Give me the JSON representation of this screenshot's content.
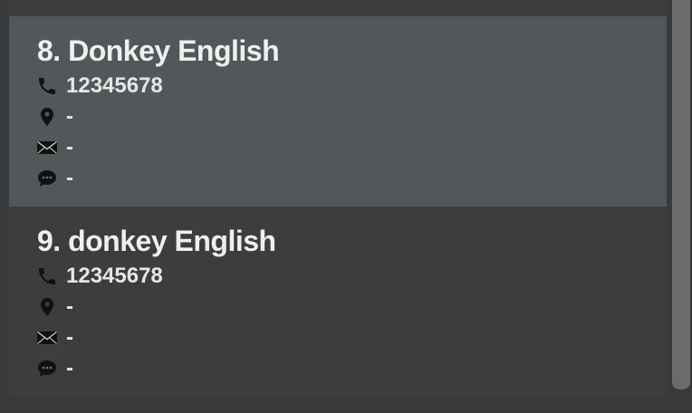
{
  "contacts": [
    {
      "name": "8. Donkey English",
      "phone": "12345678",
      "address": "-",
      "email": "-",
      "remark": "-",
      "selected": true
    },
    {
      "name": "9. donkey English",
      "phone": "12345678",
      "address": "-",
      "email": "-",
      "remark": "-",
      "selected": false
    }
  ],
  "icons": {
    "phone": "phone-icon",
    "address": "location-pin-icon",
    "email": "envelope-icon",
    "remark": "speech-bubble-icon"
  },
  "colors": {
    "selected_row": "#52575a",
    "row": "#3c3d3f",
    "background": "#38393b",
    "text": "#efefef",
    "scroll_thumb": "#6a6b6d"
  }
}
